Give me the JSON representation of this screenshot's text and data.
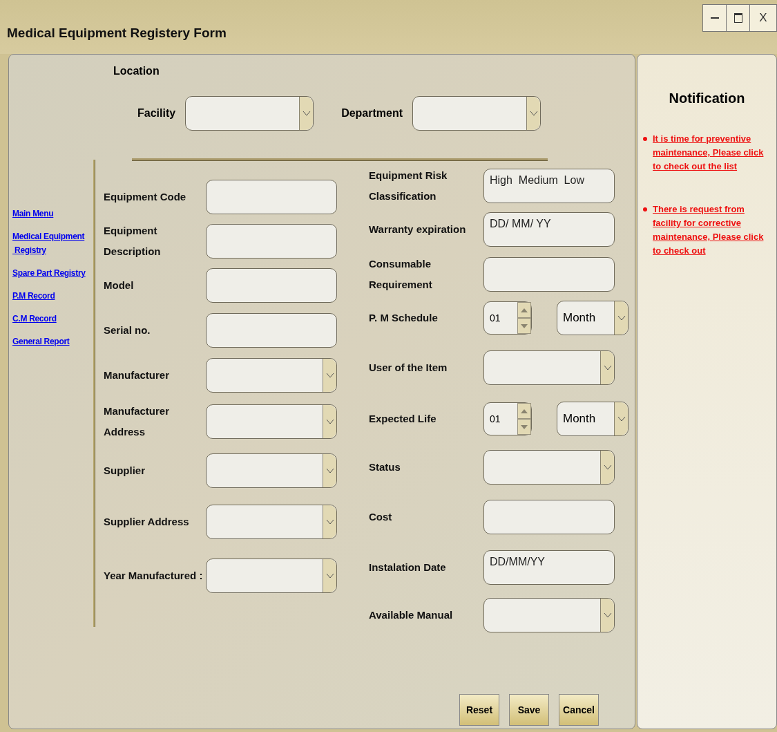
{
  "window": {
    "title": "Medical Equipment Registery Form",
    "close_label": "X"
  },
  "sidebar": {
    "links": [
      "Main Menu",
      "Medical Equipment\n Registry",
      "Spare Part Registry",
      "P.M Record",
      "C.M Record",
      "General Report"
    ]
  },
  "location": {
    "heading": "Location",
    "fields": [
      {
        "label": "Facility",
        "kind": "dropdown"
      },
      {
        "label": "Department",
        "kind": "dropdown"
      }
    ]
  },
  "form": {
    "left": [
      {
        "label": "Equipment Code",
        "kind": "text"
      },
      {
        "label": "Equipment\nDescription",
        "kind": "text"
      },
      {
        "label": "Model",
        "kind": "text"
      },
      {
        "label": "Serial no.",
        "kind": "text"
      },
      {
        "label": "Manufacturer",
        "kind": "dropdown"
      },
      {
        "label": "Manufacturer\nAddress",
        "kind": "dropdown"
      },
      {
        "label": "Supplier",
        "kind": "dropdown"
      },
      {
        "label": "Supplier Address",
        "kind": "dropdown"
      },
      {
        "label": "Year Manufactured :",
        "kind": "dropdown"
      }
    ],
    "right": [
      {
        "label": "Equipment Risk\nClassification",
        "kind": "text",
        "value": "High  Medium  Low"
      },
      {
        "label": "Warranty expiration",
        "kind": "text",
        "value": "DD/ MM/ YY"
      },
      {
        "label": "Consumable\nRequirement",
        "kind": "text"
      },
      {
        "label": "P. M Schedule",
        "kind": "spinner",
        "value": "01",
        "unit": "Month"
      },
      {
        "label": "User of the Item",
        "kind": "dropdown"
      },
      {
        "label": "Expected Life",
        "kind": "spinner",
        "value": "01",
        "unit": "Month"
      },
      {
        "label": "Status",
        "kind": "dropdown"
      },
      {
        "label": "Cost",
        "kind": "text"
      },
      {
        "label": "Instalation Date",
        "kind": "text",
        "value": "DD/MM/YY"
      },
      {
        "label": "Available Manual",
        "kind": "dropdown"
      }
    ]
  },
  "buttons": [
    "Reset",
    "Save",
    "Cancel"
  ],
  "notifications": {
    "title": "Notification",
    "items": [
      "It is time for preventive maintenance, Please click to check out the list",
      "There is request from facility for corrective maintenance, Please click to check out"
    ]
  }
}
